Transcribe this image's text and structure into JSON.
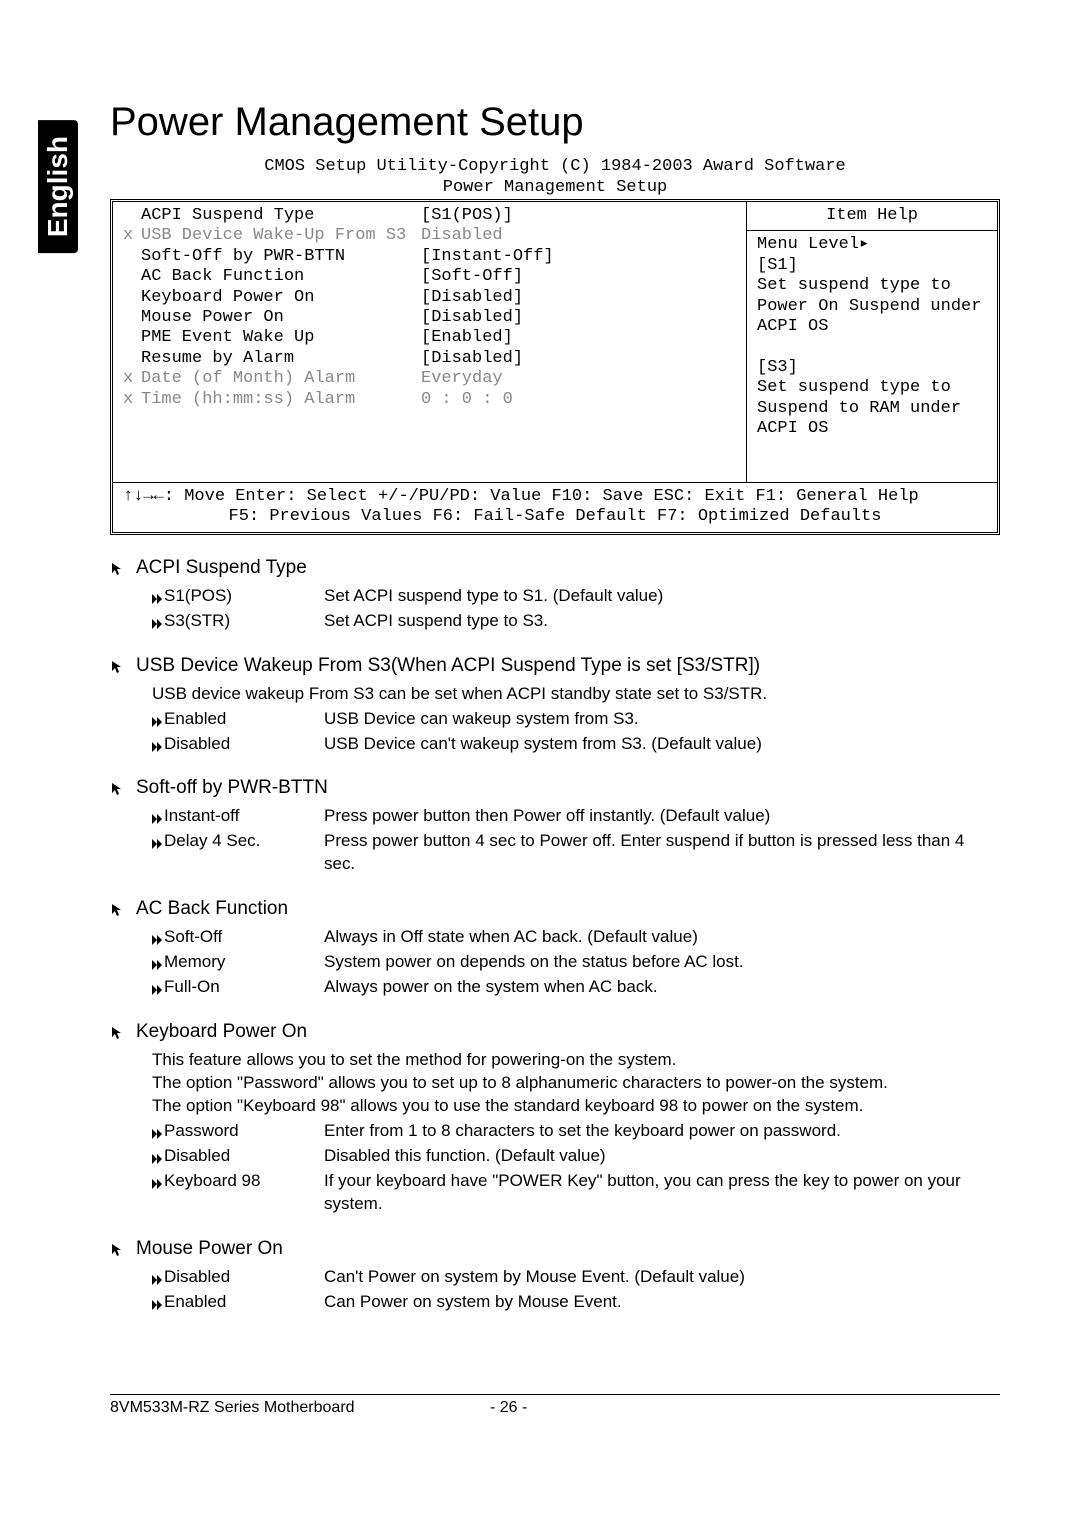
{
  "side_tab": "English",
  "page_title": "Power Management Setup",
  "bios": {
    "copyright": "CMOS Setup Utility-Copyright (C) 1984-2003 Award Software",
    "screen_title": "Power Management Setup",
    "rows": [
      {
        "marker": "",
        "label": "ACPI Suspend Type",
        "value": "[S1(POS)]",
        "gray": false
      },
      {
        "marker": "x",
        "label": "USB Device Wake-Up From S3",
        "value": "Disabled",
        "gray": true
      },
      {
        "marker": "",
        "label": "Soft-Off by PWR-BTTN",
        "value": "[Instant-Off]",
        "gray": false
      },
      {
        "marker": "",
        "label": "AC Back Function",
        "value": "[Soft-Off]",
        "gray": false
      },
      {
        "marker": "",
        "label": "Keyboard Power On",
        "value": "[Disabled]",
        "gray": false
      },
      {
        "marker": "",
        "label": "Mouse Power On",
        "value": "[Disabled]",
        "gray": false
      },
      {
        "marker": "",
        "label": "PME Event Wake Up",
        "value": "[Enabled]",
        "gray": false
      },
      {
        "marker": "",
        "label": "Resume by Alarm",
        "value": "[Disabled]",
        "gray": false
      },
      {
        "marker": "x",
        "label": "Date (of Month) Alarm",
        "value": "Everyday",
        "gray": true
      },
      {
        "marker": "x",
        "label": "Time (hh:mm:ss) Alarm",
        "value": "0 : 0 : 0",
        "gray": true
      }
    ],
    "help": {
      "title": "Item Help",
      "lines": [
        "Menu Level▸",
        "[S1]",
        "Set suspend type to",
        "Power On Suspend under",
        "ACPI OS",
        "",
        "[S3]",
        "Set suspend type to",
        "Suspend to RAM under",
        "ACPI OS"
      ]
    },
    "footer_line1": "↑↓→←: Move    Enter: Select    +/-/PU/PD: Value    F10: Save    ESC: Exit    F1: General Help",
    "footer_line2": "F5: Previous Values      F6: Fail-Safe Default          F7: Optimized Defaults"
  },
  "sections": [
    {
      "heading": "ACPI Suspend Type",
      "prelines": [],
      "options": [
        {
          "label": "S1(POS)",
          "desc": "Set ACPI suspend type to S1. (Default value)"
        },
        {
          "label": "S3(STR)",
          "desc": "Set ACPI suspend type to S3."
        }
      ]
    },
    {
      "heading": "USB Device Wakeup From S3(When ACPI Suspend Type is set [S3/STR])",
      "prelines": [
        "USB device wakeup From S3 can be set when ACPI standby state set to S3/STR."
      ],
      "options": [
        {
          "label": "Enabled",
          "desc": "USB Device can wakeup system from S3."
        },
        {
          "label": "Disabled",
          "desc": "USB Device can't wakeup system from S3. (Default value)"
        }
      ]
    },
    {
      "heading": "Soft-off by PWR-BTTN",
      "prelines": [],
      "options": [
        {
          "label": "Instant-off",
          "desc": "Press power button then Power off instantly. (Default value)"
        },
        {
          "label": "Delay 4 Sec.",
          "desc": "Press power button 4 sec to Power off. Enter suspend if button is pressed less than 4 sec."
        }
      ]
    },
    {
      "heading": "AC Back Function",
      "prelines": [],
      "options": [
        {
          "label": "Soft-Off",
          "desc": "Always in Off state when AC back. (Default value)"
        },
        {
          "label": "Memory",
          "desc": "System power on depends on the status before AC lost."
        },
        {
          "label": "Full-On",
          "desc": "Always power on the system when AC back."
        }
      ]
    },
    {
      "heading": "Keyboard Power On",
      "prelines": [
        "This feature allows you to set the method for powering-on the system.",
        "The option \"Password\" allows you to set up to 8 alphanumeric characters to power-on the system.",
        "The option \"Keyboard 98\" allows you to use the standard keyboard 98 to power on the system."
      ],
      "options": [
        {
          "label": "Password",
          "desc": "Enter from 1 to 8 characters to set the keyboard power on password."
        },
        {
          "label": "Disabled",
          "desc": "Disabled this function. (Default value)"
        },
        {
          "label": "Keyboard 98",
          "desc": "If your keyboard have \"POWER Key\" button, you can press the key to power on your system."
        }
      ]
    },
    {
      "heading": "Mouse Power On",
      "prelines": [],
      "options": [
        {
          "label": "Disabled",
          "desc": "Can't Power on system by Mouse Event. (Default value)"
        },
        {
          "label": "Enabled",
          "desc": "Can Power on system by Mouse Event."
        }
      ]
    }
  ],
  "footer": {
    "left": "8VM533M-RZ Series Motherboard",
    "center": "- 26 -"
  }
}
